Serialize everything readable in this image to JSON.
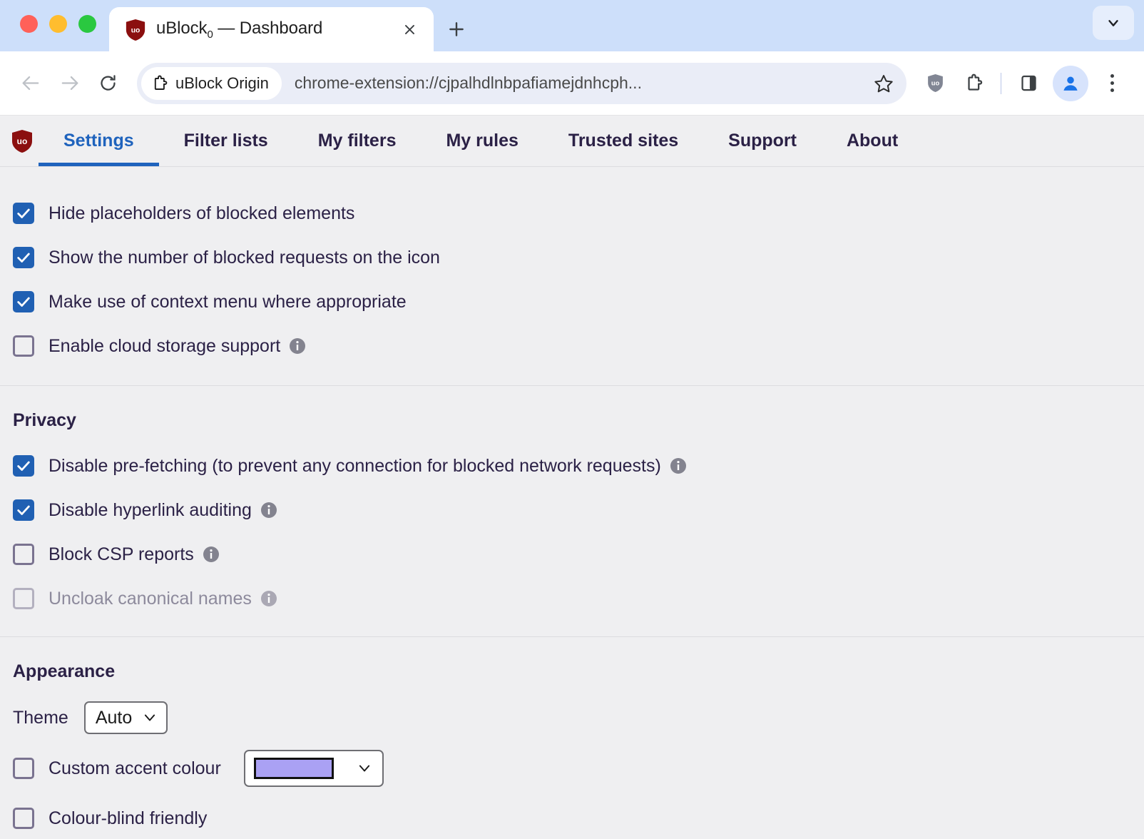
{
  "browser": {
    "tab": {
      "title_main": "uBlock",
      "title_sub": "0",
      "title_rest": " — Dashboard",
      "favicon": "ublock-shield-icon",
      "close_icon": "close-icon"
    },
    "new_tab_label": "+",
    "tabstrip_menu_icon": "chevron-down-icon",
    "nav": {
      "back_icon": "arrow-left-icon",
      "forward_icon": "arrow-right-icon",
      "reload_icon": "reload-icon"
    },
    "omnibox": {
      "extension_chip_label": "uBlock Origin",
      "extension_chip_icon": "puzzle-piece-icon",
      "url": "chrome-extension://cjpalhdlnbpafiamejdnhcph...",
      "bookmark_icon": "star-icon"
    },
    "toolbar_right": {
      "ublock_icon": "ublock-shield-icon",
      "extensions_icon": "puzzle-piece-icon",
      "side_panel_icon": "side-panel-icon",
      "profile_icon": "account-avatar-icon",
      "menu_icon": "three-dot-menu-icon"
    }
  },
  "dashboard": {
    "logo": "ublock-shield-logo",
    "tabs": [
      {
        "label": "Settings",
        "active": true
      },
      {
        "label": "Filter lists",
        "active": false
      },
      {
        "label": "My filters",
        "active": false
      },
      {
        "label": "My rules",
        "active": false
      },
      {
        "label": "Trusted sites",
        "active": false
      },
      {
        "label": "Support",
        "active": false
      },
      {
        "label": "About",
        "active": false
      }
    ],
    "general": {
      "options": [
        {
          "label": "Hide placeholders of blocked elements",
          "checked": true,
          "info": false,
          "disabled": false
        },
        {
          "label": "Show the number of blocked requests on the icon",
          "checked": true,
          "info": false,
          "disabled": false
        },
        {
          "label": "Make use of context menu where appropriate",
          "checked": true,
          "info": false,
          "disabled": false
        },
        {
          "label": "Enable cloud storage support",
          "checked": false,
          "info": true,
          "disabled": false
        }
      ]
    },
    "privacy": {
      "title": "Privacy",
      "options": [
        {
          "label": "Disable pre-fetching (to prevent any connection for blocked network requests)",
          "checked": true,
          "info": true,
          "disabled": false
        },
        {
          "label": "Disable hyperlink auditing",
          "checked": true,
          "info": true,
          "disabled": false
        },
        {
          "label": "Block CSP reports",
          "checked": false,
          "info": true,
          "disabled": false
        },
        {
          "label": "Uncloak canonical names",
          "checked": false,
          "info": true,
          "disabled": true
        }
      ]
    },
    "appearance": {
      "title": "Appearance",
      "theme_label": "Theme",
      "theme_value": "Auto",
      "accent_label": "Custom accent colour",
      "accent_checked": false,
      "accent_colour": "#aaa1f4",
      "colour_blind_label": "Colour-blind friendly",
      "colour_blind_checked": false
    }
  },
  "colors": {
    "accent_blue": "#2060b3",
    "tab_active_blue": "#1f63bd",
    "text_purple": "#2b2146",
    "ublock_red": "#8b0f0f",
    "page_bg": "#efeff1",
    "tabstrip_bg": "#cddffa"
  }
}
